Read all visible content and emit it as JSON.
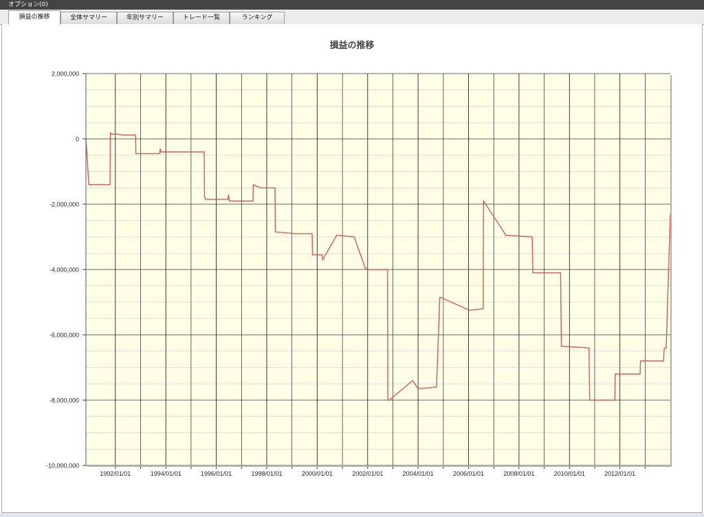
{
  "window": {
    "menu_label": "オプション(0)"
  },
  "tabs": [
    {
      "label": "損益の推移",
      "active": true
    },
    {
      "label": "全体サマリー",
      "active": false
    },
    {
      "label": "年別サマリー",
      "active": false
    },
    {
      "label": "トレード一覧",
      "active": false
    },
    {
      "label": "ランキング",
      "active": false
    }
  ],
  "colors": {
    "line": "#e05555",
    "plot_bg": "#ffffe8",
    "major_grid": "#333333",
    "minor_grid": "#999999"
  },
  "chart_data": {
    "type": "line",
    "title": "損益の推移",
    "xlabel": "",
    "ylabel": "",
    "ylim": [
      -10000000,
      2000000
    ],
    "xlim": [
      "1990-11-01",
      "2013-12-31"
    ],
    "grid": true,
    "y_ticks": [
      2000000,
      0,
      -2000000,
      -4000000,
      -6000000,
      -8000000,
      -10000000
    ],
    "y_tick_labels": [
      "2,000,000",
      "0",
      "-2,000,000",
      "-4,000,000",
      "-6,000,000",
      "-8,000,000",
      "-10,000,000"
    ],
    "x_ticks": [
      "1992-01-01",
      "1993-01-01",
      "1994-01-01",
      "1995-01-01",
      "1996-01-01",
      "1997-01-01",
      "1998-01-01",
      "1999-01-01",
      "2000-01-01",
      "2001-01-01",
      "2002-01-01",
      "2003-01-01",
      "2004-01-01",
      "2005-01-01",
      "2006-01-01",
      "2007-01-01",
      "2008-01-01",
      "2009-01-01",
      "2010-01-01",
      "2011-01-01",
      "2012-01-01",
      "2013-01-01"
    ],
    "x_tick_labels": [
      "1992/01/01",
      "",
      "1994/01/01",
      "",
      "1996/01/01",
      "",
      "1998/01/01",
      "",
      "2000/01/01",
      "",
      "2002/01/01",
      "",
      "2004/01/01",
      "",
      "2006/01/01",
      "",
      "2008/01/01",
      "",
      "2010/01/01",
      "",
      "2012/01/01",
      ""
    ],
    "series": [
      {
        "x": [
          "1990-11-01",
          "1990-12-10",
          "1990-12-15",
          "1991-10-15",
          "1991-10-20",
          "1991-11-01",
          "1992-01-15",
          "1992-04-20",
          "1992-10-20",
          "1992-10-25",
          "1993-10-05",
          "1993-10-10",
          "1993-10-25",
          "1994-01-20",
          "1994-04-25",
          "1995-07-10",
          "1995-07-15",
          "1995-07-25",
          "1995-07-30",
          "1996-06-20",
          "1996-06-25",
          "1996-07-10",
          "1996-07-15",
          "1997-06-15",
          "1997-06-20",
          "1997-09-30",
          "1997-10-05",
          "1998-04-30",
          "1998-05-05",
          "1999-02-20",
          "1999-03-05",
          "1999-10-20",
          "1999-10-25",
          "1999-11-05",
          "2000-03-15",
          "2000-03-20",
          "2000-10-10",
          "2001-06-15",
          "2001-06-20",
          "2001-11-25",
          "2002-01-10",
          "2002-10-15",
          "2002-10-20",
          "2002-11-05",
          "2002-11-10",
          "2003-10-15",
          "2004-01-01",
          "2004-09-20",
          "2004-09-25",
          "2004-11-10",
          "2004-11-20",
          "2005-11-25",
          "2005-12-05",
          "2006-01-10",
          "2006-08-01",
          "2006-08-05",
          "2007-06-10",
          "2007-06-20",
          "2008-07-10",
          "2008-07-20",
          "2009-08-25",
          "2009-09-05",
          "2010-10-10",
          "2010-10-20",
          "2011-10-20",
          "2011-10-25",
          "2012-10-20",
          "2012-10-25",
          "2013-09-25",
          "2013-10-01",
          "2013-10-15",
          "2013-11-01",
          "2013-12-31"
        ],
        "y": [
          0,
          -1300000,
          -1400000,
          -1400000,
          200000,
          150000,
          150000,
          120000,
          120000,
          -450000,
          -450000,
          -300000,
          -400000,
          -400000,
          -400000,
          -400000,
          -1800000,
          -1800000,
          -1850000,
          -1850000,
          -1700000,
          -1900000,
          -1900000,
          -1900000,
          -1400000,
          -1500000,
          -1500000,
          -1500000,
          -2850000,
          -2900000,
          -2900000,
          -2900000,
          -3550000,
          -3550000,
          -3550000,
          -3700000,
          -2950000,
          -3000000,
          -3000000,
          -3950000,
          -4000000,
          -4000000,
          -8000000,
          -8000000,
          -8000000,
          -7400000,
          -7650000,
          -7600000,
          -7550000,
          -4850000,
          -4850000,
          -5200000,
          -5200000,
          -5250000,
          -5200000,
          -1900000,
          -2900000,
          -2950000,
          -3000000,
          -4100000,
          -4100000,
          -6350000,
          -6400000,
          -8000000,
          -8000000,
          -7200000,
          -7200000,
          -6800000,
          -6800000,
          -6450000,
          -6400000,
          -6400000,
          -2300000
        ]
      }
    ]
  }
}
